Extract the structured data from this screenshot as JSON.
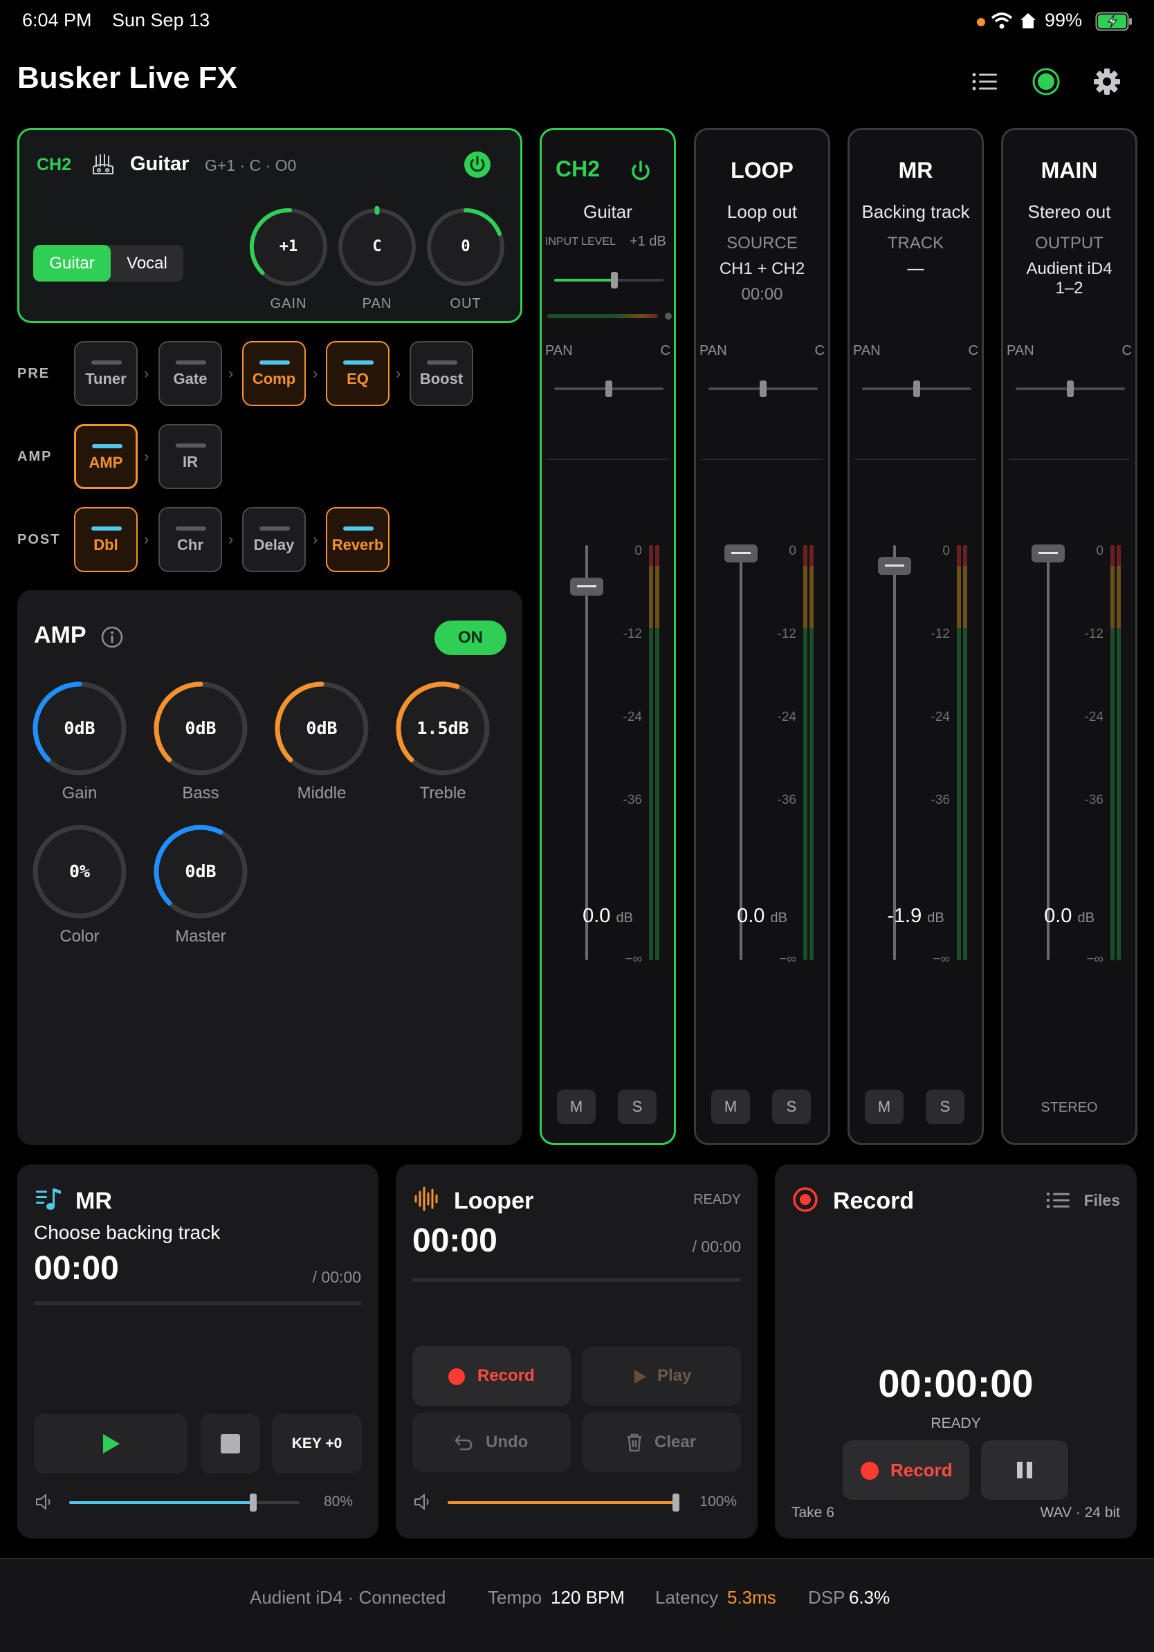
{
  "status_bar": {
    "time": "6:04 PM",
    "date": "Sun Sep 13",
    "battery": "99%"
  },
  "app": {
    "title": "Busker Live FX"
  },
  "channel": {
    "id": "CH2",
    "name": "Guitar",
    "meta": "G+1 · C · O0",
    "modes": [
      "Guitar",
      "Vocal"
    ],
    "active_mode": "Guitar",
    "knobs": [
      {
        "label": "GAIN",
        "value": "+1"
      },
      {
        "label": "PAN",
        "value": "C"
      },
      {
        "label": "OUT",
        "value": "0"
      }
    ]
  },
  "chain": {
    "pre": {
      "label": "PRE",
      "items": [
        "Tuner",
        "Gate",
        "Comp",
        "EQ",
        "Boost"
      ]
    },
    "amp": {
      "label": "AMP",
      "items": [
        "AMP",
        "IR"
      ]
    },
    "post": {
      "label": "POST",
      "items": [
        "Dbl",
        "Chr",
        "Delay",
        "Reverb"
      ]
    }
  },
  "amp_panel": {
    "title": "AMP",
    "toggle": "ON",
    "knobs": [
      {
        "label": "Gain",
        "value": "0dB",
        "level": 0.5
      },
      {
        "label": "Bass",
        "value": "0dB",
        "level": 0.5
      },
      {
        "label": "Middle",
        "value": "0dB",
        "level": 0.5
      },
      {
        "label": "Treble",
        "value": "1.5dB",
        "level": 0.57
      },
      {
        "label": "Color",
        "value": "0%",
        "level": 0
      },
      {
        "label": "Master",
        "value": "0dB",
        "level": 0.6
      }
    ]
  },
  "mixer": {
    "scale": [
      "0",
      "-12",
      "-24",
      "-36",
      "−∞"
    ],
    "strips": [
      {
        "name": "CH2",
        "sub": "Guitar",
        "input_label": "INPUT LEVEL",
        "input_value": "+1 dB",
        "pan_label": "PAN",
        "pan_value": "C",
        "db": "0.0",
        "unit": "dB",
        "m": "M",
        "s": "S",
        "fader": 0.9
      },
      {
        "name": "LOOP",
        "sub": "Loop out",
        "k": "SOURCE",
        "v": "CH1 + CH2",
        "v2": "00:00",
        "pan_label": "PAN",
        "pan_value": "C",
        "db": "0.0",
        "unit": "dB",
        "m": "M",
        "s": "S",
        "fader": 0.98
      },
      {
        "name": "MR",
        "sub": "Backing track",
        "k": "TRACK",
        "v": "—",
        "pan_label": "PAN",
        "pan_value": "C",
        "db": "-1.9",
        "unit": "dB",
        "m": "M",
        "s": "S",
        "fader": 0.95
      },
      {
        "name": "MAIN",
        "sub": "Stereo out",
        "k": "OUTPUT",
        "v": "Audient iD4",
        "v2": "1–2",
        "pan_label": "PAN",
        "pan_value": "C",
        "db": "0.0",
        "unit": "dB",
        "footer": "STEREO",
        "fader": 0.98
      }
    ]
  },
  "mr": {
    "title": "MR",
    "prompt": "Choose backing track",
    "time": "00:00",
    "total": "/ 00:00",
    "key": "KEY +0",
    "volume": "80%",
    "volume_level": 0.8
  },
  "looper": {
    "title": "Looper",
    "status": "READY",
    "time": "00:00",
    "total": "/ 00:00",
    "record": "Record",
    "play": "Play",
    "undo": "Undo",
    "clear": "Clear",
    "volume": "100%",
    "volume_level": 1.0
  },
  "record": {
    "title": "Record",
    "files": "Files",
    "time": "00:00:00",
    "status": "READY",
    "record": "Record",
    "take": "Take 6",
    "format": "WAV · 24 bit"
  },
  "footer": {
    "device": "Audient iD4 · Connected",
    "tempo_label": "Tempo",
    "tempo": "120 BPM",
    "latency_label": "Latency",
    "latency": "5.3ms",
    "dsp_label": "DSP",
    "dsp": "6.3%"
  },
  "colors": {
    "green": "#2fcf55",
    "orange": "#f5922e",
    "blue": "#1f8fff",
    "cyan": "#4ec7ec",
    "red": "#ff3b30"
  }
}
